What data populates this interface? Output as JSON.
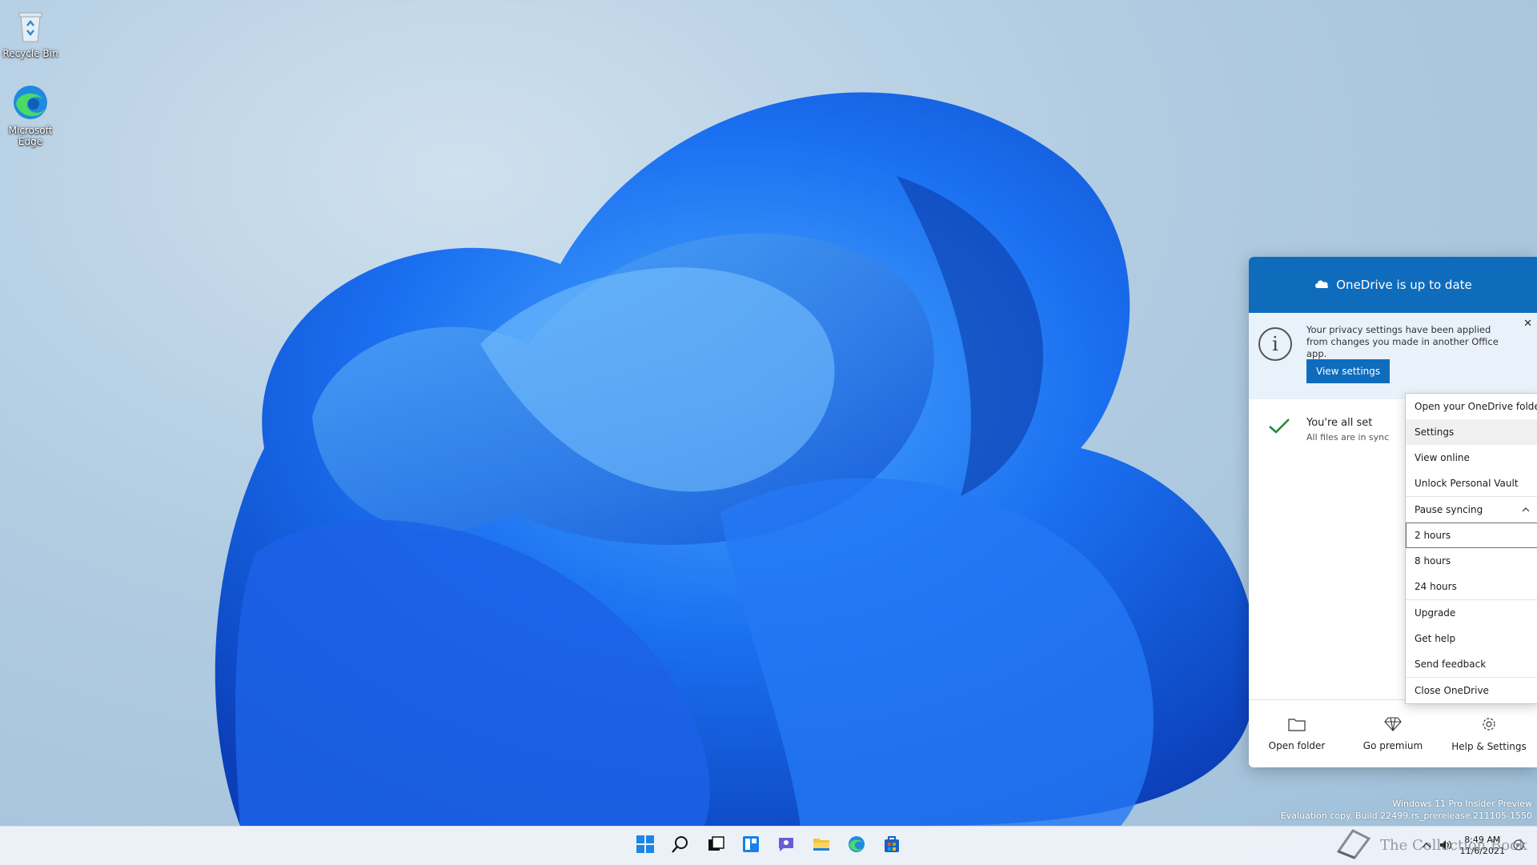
{
  "desktop": {
    "icons": [
      {
        "label": "Recycle Bin"
      },
      {
        "label": "Microsoft Edge"
      }
    ]
  },
  "onedrive": {
    "header_title": "OneDrive is up to date",
    "notice": {
      "text": "Your privacy settings have been applied from changes you made in another Office app.",
      "button_label": "View settings",
      "close_glyph": "✕"
    },
    "status": {
      "title": "You're all set",
      "subtitle": "All files are in sync"
    },
    "footer": [
      {
        "label": "Open folder",
        "icon": "folder-icon"
      },
      {
        "label": "Go premium",
        "icon": "diamond-icon"
      },
      {
        "label": "Help & Settings",
        "icon": "gear-icon"
      }
    ],
    "accent_color": "#0f6cbd"
  },
  "context_menu": {
    "items": [
      {
        "label": "Open your OneDrive folder"
      },
      {
        "label": "Settings"
      },
      {
        "label": "View online"
      },
      {
        "label": "Unlock Personal Vault"
      },
      {
        "label": "Pause syncing"
      },
      {
        "label": "2 hours"
      },
      {
        "label": "8 hours"
      },
      {
        "label": "24 hours"
      },
      {
        "label": "Upgrade"
      },
      {
        "label": "Get help"
      },
      {
        "label": "Send feedback"
      },
      {
        "label": "Close OneDrive"
      }
    ]
  },
  "watermark": {
    "line1": "Windows 11 Pro Insider Preview",
    "line2": "Evaluation copy. Build 22499.rs_prerelease.211105-1550"
  },
  "taskbar": {
    "apps": [
      "start-icon",
      "search-icon",
      "task-view-icon",
      "widgets-icon",
      "chat-icon",
      "file-explorer-icon",
      "edge-icon",
      "store-icon"
    ],
    "time": "8:49 AM",
    "date": "11/6/2021"
  },
  "brand_overlay": {
    "text": "The Collection Book"
  }
}
